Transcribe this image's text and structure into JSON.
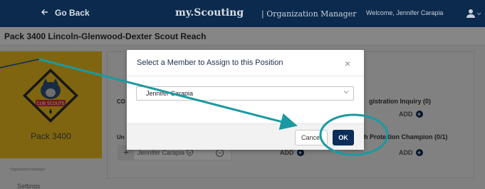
{
  "topbar": {
    "back_label": "Go Back",
    "brand": "my.Scouting",
    "brand_sub": "| Organization Manager",
    "welcome": "Welcome, Jennifer Carapia"
  },
  "page": {
    "unit_title": "Pack 3400 Lincoln-Glenwood-Dexter Scout Reach"
  },
  "sidebar": {
    "pack_name": "Pack 3400",
    "section_label": "Organization Manager",
    "settings_label": "Settings",
    "logo_text": "CUB SCOUTS"
  },
  "background": {
    "co_label": "CO",
    "un_label": "Un",
    "registration_inquiry": "gistration Inquiry (0)",
    "youth_protection": "th Prote tion Champion (0/1)",
    "add_label": "ADD",
    "slot_plus": "+",
    "slot_member_name": "Jennifer Carapia",
    "slot_minus": "–"
  },
  "modal": {
    "title": "Select a Member to Assign to this Position",
    "close_symbol": "×",
    "selected_member": "Jennifer Carapia",
    "cancel_label": "Cancel",
    "ok_label": "OK"
  },
  "colors": {
    "navy": "#0c2a4d",
    "ok_button": "#0b2d59",
    "annotation_teal": "#1a9aa0",
    "sidebar_yellow": "#e8b81d"
  },
  "icons": {
    "back": "arrow-left-icon",
    "user": "user-icon",
    "close": "close-icon",
    "dropdown": "chevron-down-icon",
    "add": "plus-circle-icon",
    "shield": "shield-check-icon",
    "remove": "minus-circle-icon"
  }
}
